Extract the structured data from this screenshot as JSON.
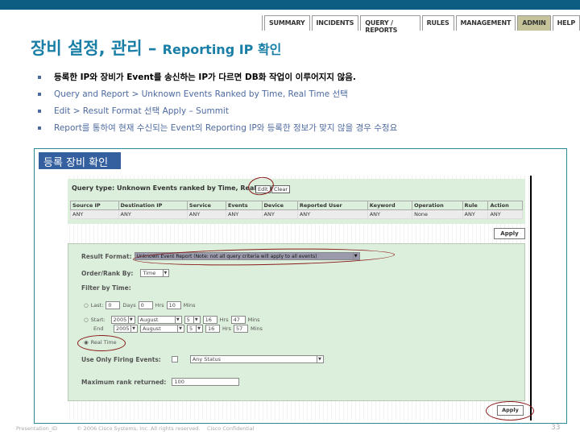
{
  "nav": {
    "tabs": [
      "SUMMARY",
      "INCIDENTS",
      "QUERY / REPORTS",
      "RULES",
      "MANAGEMENT",
      "ADMIN",
      "HELP"
    ],
    "active": "ADMIN"
  },
  "title": {
    "main": "장비 설정, 관리 – ",
    "sub": "Reporting IP 확인"
  },
  "bullets": [
    "등록한 IP와 장비가 Event를 송신하는 IP가 다르면 DB화 작업이 이루어지지 않음.",
    "Query and Report > Unknown Events Ranked by Time, Real Time 선택",
    "Edit > Result Format 선택  Apply – Summit",
    "Report를 통하여 현재 수신되는 Event의 Reporting IP와 등록한 정보가 맞지 않을 경우 수정요"
  ],
  "box_label": "등록 장비 확인",
  "query": {
    "title": "Query type: Unknown Events ranked by Time, Real Time",
    "edit": "Edit",
    "clear": "Clear",
    "columns": [
      "Source IP",
      "Destination IP",
      "Service",
      "Events",
      "Device",
      "Reported User",
      "Keyword",
      "Operation",
      "Rule",
      "Action"
    ],
    "values": [
      "ANY",
      "ANY",
      "ANY",
      "ANY",
      "ANY",
      "ANY",
      "ANY",
      "None",
      "ANY",
      "ANY"
    ]
  },
  "apply": "Apply",
  "form": {
    "result_format_label": "Result Format:",
    "result_format_value": "Unknown Event Report (Note: not all query criteria will apply to all events)",
    "order_label": "Order/Rank By:",
    "order_value": "Time",
    "filter_label": "Filter by Time:",
    "last": {
      "label": "Last:",
      "days": "0",
      "days_label": "Days",
      "hrs": "0",
      "hrs_label": "Hrs",
      "mins": "10",
      "mins_label": "Mins"
    },
    "start": {
      "label": "Start:",
      "year": "2005",
      "month": "August",
      "day": "5",
      "hrs": "16",
      "hrs_label": "Hrs",
      "mins": "47",
      "mins_label": "Mins"
    },
    "end": {
      "label": "End",
      "year": "2005",
      "month": "August",
      "day": "5",
      "hrs": "16",
      "hrs_label": "Hrs",
      "mins": "57",
      "mins_label": "Mins"
    },
    "real_time": "Real Time",
    "time_mode": "Real Time",
    "firing_label": "Use Only Firing Events:",
    "firing_status": "Any Status",
    "firing_checked": false,
    "max_label": "Maximum rank returned:",
    "max_value": "100"
  },
  "footer": {
    "id": "Presentation_ID",
    "copyright": "© 2006 Cisco Systems, Inc. All rights reserved.",
    "confidential": "Cisco Confidential",
    "page": "33"
  }
}
